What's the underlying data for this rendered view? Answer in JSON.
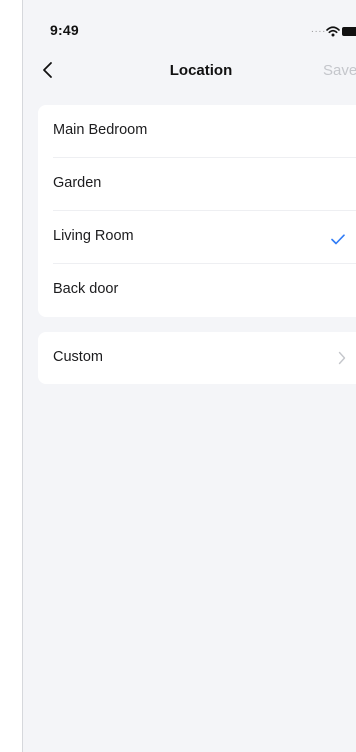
{
  "status_bar": {
    "time": "9:49",
    "signal_text": "....",
    "wifi_icon": "wifi-icon",
    "battery_icon": "battery-icon"
  },
  "nav": {
    "back_icon": "chevron-left-icon",
    "title": "Location",
    "save_label": "Save"
  },
  "locations": {
    "items": [
      {
        "label": "Main Bedroom",
        "selected": false
      },
      {
        "label": "Garden",
        "selected": false
      },
      {
        "label": "Living Room",
        "selected": true
      },
      {
        "label": "Back door",
        "selected": false
      }
    ],
    "selected_icon": "checkmark-icon"
  },
  "custom": {
    "label": "Custom",
    "icon": "chevron-right-icon"
  },
  "colors": {
    "background": "#f4f5f8",
    "card": "#ffffff",
    "accent": "#2f7bf6",
    "disabled_text": "#c4c6cb"
  }
}
